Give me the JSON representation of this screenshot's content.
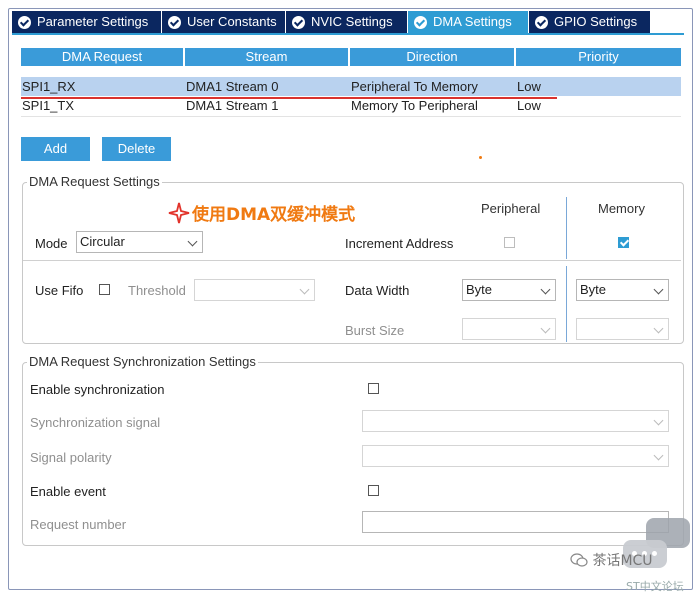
{
  "tabs": [
    {
      "label": "Parameter Settings",
      "active": false
    },
    {
      "label": "User Constants",
      "active": false
    },
    {
      "label": "NVIC Settings",
      "active": false
    },
    {
      "label": "DMA Settings",
      "active": true
    },
    {
      "label": "GPIO Settings",
      "active": false
    }
  ],
  "table": {
    "headers": [
      "DMA Request",
      "Stream",
      "Direction",
      "Priority"
    ],
    "rows": [
      [
        "SPI1_RX",
        "DMA1 Stream 0",
        "Peripheral To Memory",
        "Low"
      ],
      [
        "SPI1_TX",
        "DMA1 Stream 1",
        "Memory To Peripheral",
        "Low"
      ]
    ]
  },
  "buttons": {
    "add": "Add",
    "delete": "Delete"
  },
  "dma_settings": {
    "legend": "DMA Request Settings",
    "annotation": "使用DMA双缓冲模式",
    "peripheral_header": "Peripheral",
    "memory_header": "Memory",
    "mode_label": "Mode",
    "mode_value": "Circular",
    "increment_label": "Increment Address",
    "use_fifo_label": "Use Fifo",
    "threshold_label": "Threshold",
    "data_width_label": "Data Width",
    "data_width_peripheral": "Byte",
    "data_width_memory": "Byte",
    "burst_size_label": "Burst Size"
  },
  "sync_settings": {
    "legend": "DMA Request Synchronization Settings",
    "enable_sync_label": "Enable synchronization",
    "sync_signal_label": "Synchronization signal",
    "signal_polarity_label": "Signal polarity",
    "enable_event_label": "Enable event",
    "request_number_label": "Request number"
  },
  "watermark": {
    "text": "茶话MCU",
    "sub": "ST中文论坛"
  },
  "colors": {
    "tab_active": "#2e9cd3",
    "tab_inactive": "#0b2760",
    "header_blue": "#3a9bd9",
    "selected_row": "#b9d2ef",
    "annotation": "#f07a12"
  }
}
